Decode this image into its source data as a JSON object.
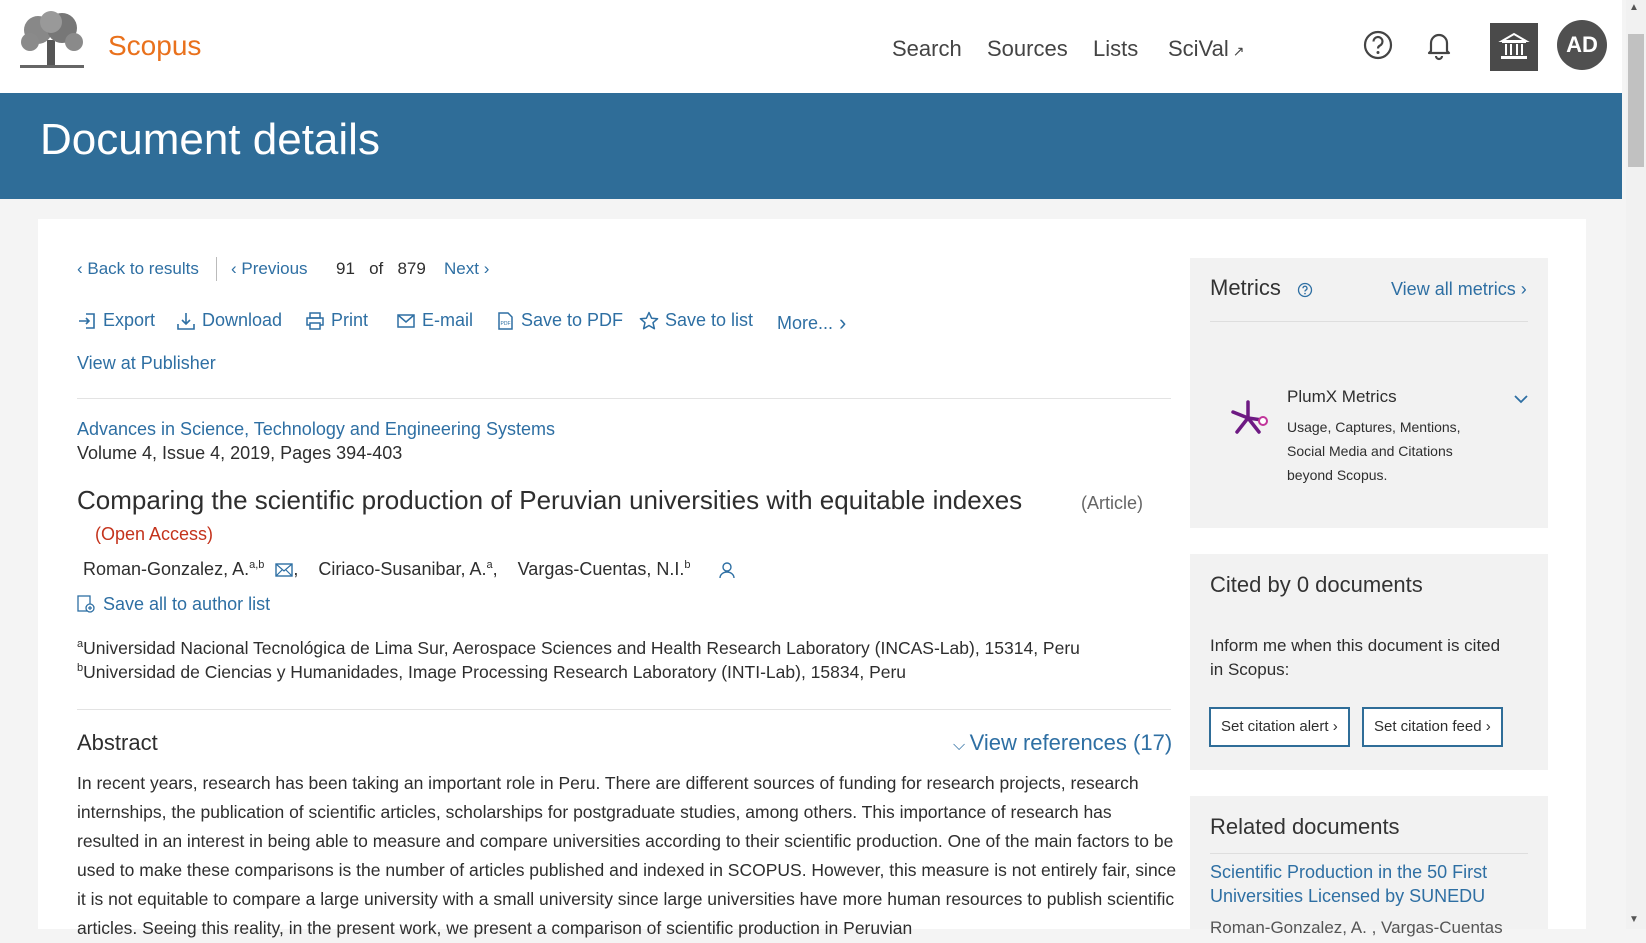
{
  "header": {
    "brand": "Scopus",
    "nav": [
      "Search",
      "Sources",
      "Lists",
      "SciVal"
    ],
    "sival_ext": "↗",
    "avatar": "AD"
  },
  "banner": {
    "title": "Document details"
  },
  "pager": {
    "back": "Back to results",
    "previous": "Previous",
    "current": "91",
    "of": "of",
    "total": "879",
    "next": "Next"
  },
  "actions": {
    "export": "Export",
    "download": "Download",
    "print": "Print",
    "email": "E-mail",
    "save_pdf": "Save to PDF",
    "save_list": "Save to list",
    "more": "More...",
    "view_publisher": "View at Publisher"
  },
  "document": {
    "source": "Advances in Science, Technology and Engineering Systems",
    "volume": "Volume 4, Issue 4, 2019, Pages 394-403",
    "title": "Comparing the scientific production of Peruvian universities with equitable indexes",
    "type": "(Article)",
    "open_access": "(Open Access)",
    "authors": [
      {
        "name": "Roman-Gonzalez, A.",
        "sup": "a,b"
      },
      {
        "name": "Ciriaco-Susanibar, A.",
        "sup": "a"
      },
      {
        "name": "Vargas-Cuentas, N.I.",
        "sup": "b"
      }
    ],
    "save_authors": "Save all to author list",
    "affiliations": [
      {
        "sup": "a",
        "text": "Universidad Nacional Tecnológica de Lima Sur, Aerospace Sciences and Health Research Laboratory (INCAS-Lab), 15314, Peru"
      },
      {
        "sup": "b",
        "text": "Universidad de Ciencias y Humanidades, Image Processing Research Laboratory (INTI-Lab), 15834, Peru"
      }
    ],
    "abstract_heading": "Abstract",
    "view_references": "View references (17)",
    "abstract": "In recent years, research has been taking an important role in Peru. There are different sources of funding for research projects, research internships, the publication of scientific articles, scholarships for postgraduate studies, among others. This importance of research has resulted in an interest in being able to measure and compare universities according to their scientific production. One of the main factors to be used to make these comparisons is the number of articles published and indexed in SCOPUS. However, this measure is not entirely fair, since it is not equitable to compare a large university with a small university since large universities have more human resources to publish scientific articles. Seeing this reality, in the present work, we present a comparison of scientific production in Peruvian"
  },
  "metrics": {
    "title": "Metrics",
    "view_all": "View all metrics",
    "plumx_title": "PlumX Metrics",
    "plumx_desc": [
      "Usage, Captures, Mentions,",
      "Social Media and Citations",
      "beyond Scopus."
    ]
  },
  "cited": {
    "title": "Cited by 0 documents",
    "inform": [
      "Inform me when this document is cited",
      "in Scopus:"
    ],
    "alert_btn": "Set citation alert",
    "feed_btn": "Set citation feed"
  },
  "related": {
    "title": "Related documents",
    "first_title": [
      "Scientific Production in the 50 First",
      "Universities Licensed by SUNEDU"
    ],
    "first_authors": "Roman-Gonzalez, A. , Vargas-Cuentas"
  },
  "colors": {
    "banner": "#2f6d98",
    "brand": "#e9711c",
    "link": "#2e6fa3",
    "open_access": "#c4331c",
    "plumx": "#6e1a83"
  }
}
